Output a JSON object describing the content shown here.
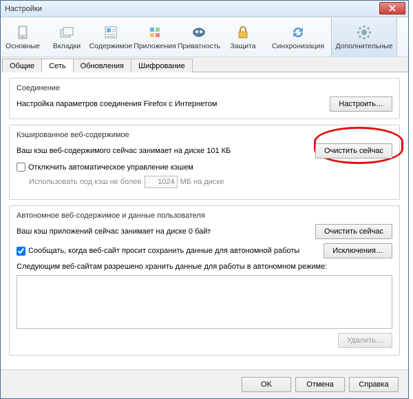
{
  "title": "Настройки",
  "toolbar": [
    {
      "label": "Основные",
      "icon": "general"
    },
    {
      "label": "Вкладки",
      "icon": "tabs"
    },
    {
      "label": "Содержимое",
      "icon": "content"
    },
    {
      "label": "Приложения",
      "icon": "apps"
    },
    {
      "label": "Приватность",
      "icon": "privacy"
    },
    {
      "label": "Защита",
      "icon": "security"
    },
    {
      "label": "Синхронизация",
      "icon": "sync"
    },
    {
      "label": "Дополнительные",
      "icon": "advanced"
    }
  ],
  "tabs": [
    "Общие",
    "Сеть",
    "Обновления",
    "Шифрование"
  ],
  "active_tab": 1,
  "connection": {
    "title": "Соединение",
    "desc": "Настройка параметров соединения Firefox с Интернетом",
    "settings_btn": "Настроить…"
  },
  "cache": {
    "title": "Кэшированное веб-содержимое",
    "usage": "Ваш кэш веб-содержимого сейчас занимает на диске 101 КБ",
    "clear_btn": "Очистить сейчас",
    "override_chk": "Отключить автоматическое управление кэшем",
    "limit_label_pre": "Использовать под кэш не более",
    "limit_value": "1024",
    "limit_label_post": "МБ на диске"
  },
  "offline": {
    "title": "Автономное веб-содержимое и данные пользователя",
    "usage": "Ваш кэш приложений сейчас занимает на диске 0 байт",
    "clear_btn": "Очистить сейчас",
    "notify_chk": "Сообщать, когда веб-сайт просит сохранить данные для автономной работы",
    "exceptions_btn": "Исключения…",
    "list_label": "Следующим веб-сайтам разрешено хранить данные для работы в автономном режиме:",
    "remove_btn": "Удалить…"
  },
  "footer": {
    "ok": "OK",
    "cancel": "Отмена",
    "help": "Справка"
  }
}
